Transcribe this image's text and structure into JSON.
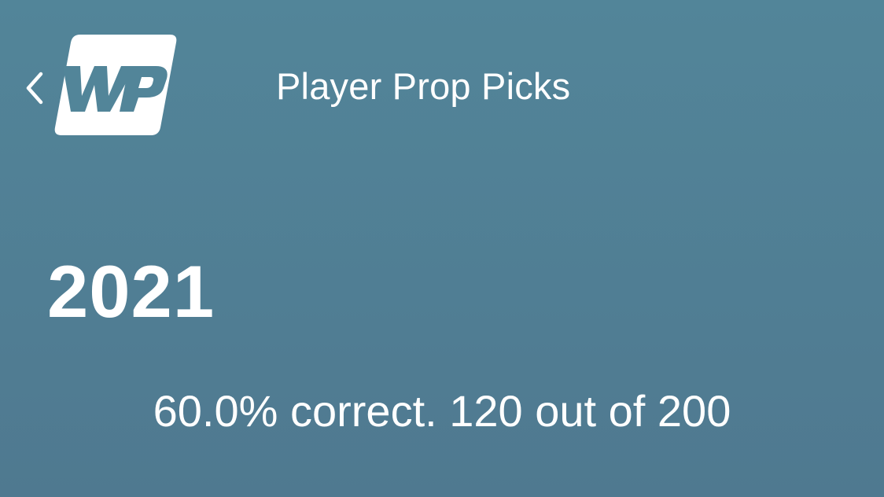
{
  "header": {
    "back_icon": "chevron-left-icon",
    "logo_text": "WP",
    "title": "Player Prop Picks"
  },
  "stats": {
    "year": "2021",
    "summary": "60.0% correct. 120 out of 200"
  },
  "colors": {
    "background_top": "#528599",
    "background_bottom": "#4f7990",
    "text": "#ffffff"
  }
}
